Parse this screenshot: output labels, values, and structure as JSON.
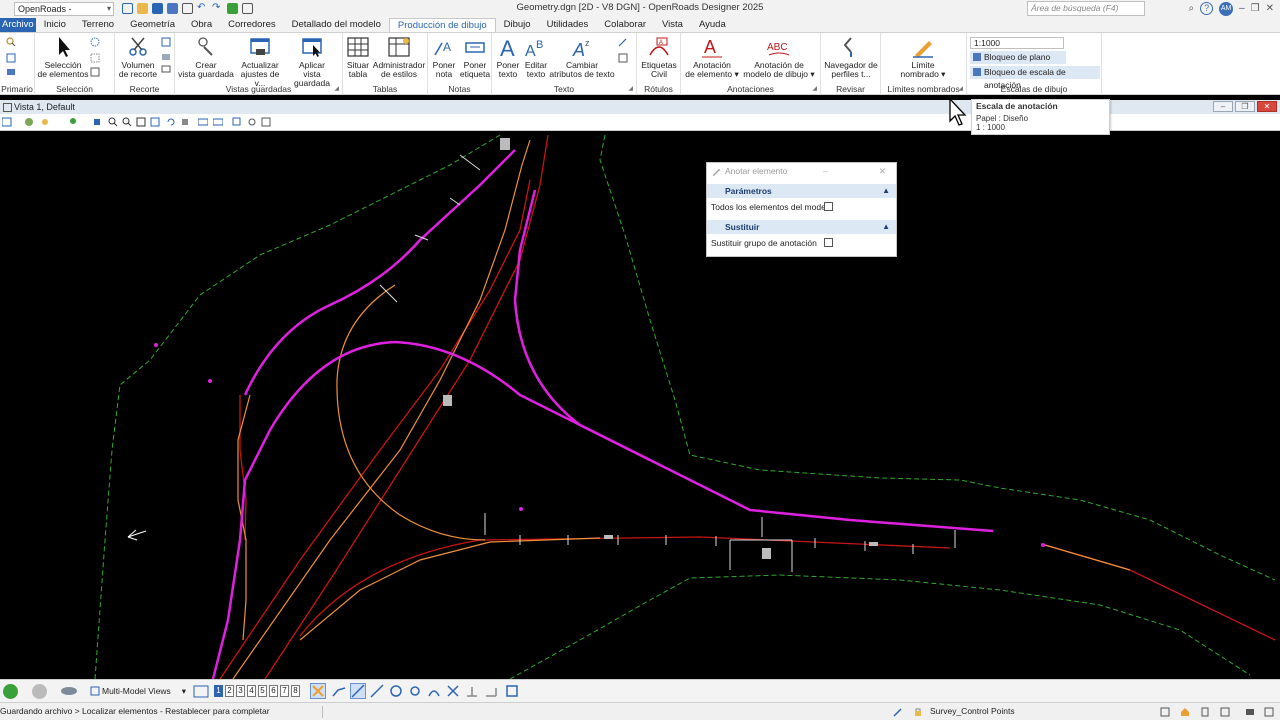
{
  "titlebar": {
    "workspace": "OpenRoads - Modelado",
    "title": "Geometry.dgn [2D - V8 DGN] - OpenRoads Designer 2025",
    "search_placeholder": "Área de búsqueda (F4)",
    "user_initials": "AM",
    "help": "?"
  },
  "tabs": [
    "Archivo",
    "Inicio",
    "Terreno",
    "Geometría",
    "Obra",
    "Corredores",
    "Detallado del modelo",
    "Producción de dibujo",
    "Dibujo",
    "Utilidades",
    "Colaborar",
    "Vista",
    "Ayuda"
  ],
  "active_tab": "Producción de dibujo",
  "ribbon": {
    "groups": {
      "primario": "Primario",
      "seleccion": "Selección",
      "recorte": "Recorte",
      "vistas": "Vistas guardadas",
      "tablas": "Tablas",
      "notas": "Notas",
      "texto": "Texto",
      "rotulos": "Rótulos",
      "anotaciones": "Anotaciones",
      "revisar": "Revisar",
      "limites": "Límites nombrados",
      "escalas": "Escalas de dibujo"
    },
    "buttons": {
      "seleccion1": "Selección",
      "seleccion2": "de elementos",
      "volumen1": "Volumen",
      "volumen2": "de recorte",
      "crear1": "Crear",
      "crear2": "vista guardada",
      "actualizar1": "Actualizar",
      "actualizar2": "ajustes de v...",
      "aplicar1": "Aplicar",
      "aplicar2": "vista guardada",
      "situar1": "Situar",
      "situar2": "tabla",
      "admin1": "Administrador",
      "admin2": "de estilos",
      "poner_nota1": "Poner",
      "poner_nota2": "nota",
      "poner_etiq1": "Poner",
      "poner_etiq2": "etiqueta",
      "poner_texto1": "Poner",
      "poner_texto2": "texto",
      "editar_texto1": "Editar",
      "editar_texto2": "texto",
      "cambiar1": "Cambiar",
      "cambiar2": "atributos de texto",
      "etiquetas1": "Etiquetas",
      "etiquetas2": "Civil",
      "anot_elem1": "Anotación",
      "anot_elem2": "de elemento",
      "anot_modelo1": "Anotación de",
      "anot_modelo2": "modelo de dibujo",
      "navegador1": "Navegador de",
      "navegador2": "perfiles t...",
      "limite1": "Límite",
      "limite2": "nombrado"
    },
    "scale_value": "1:1000",
    "lock_sca": "Bloqueo de plano SCA",
    "lock_annot": "Bloqueo de escala de anotación"
  },
  "tooltip": {
    "title": "Escala de anotación",
    "line1": "Papel : Diseño",
    "line2": "1 : 1000"
  },
  "view": {
    "title": "Vista 1, Default"
  },
  "dialog": {
    "title": "Anotar elemento",
    "section1": "Parámetros",
    "row1": "Todos los elementos del modelo",
    "section2": "Sustituir",
    "row2": "Sustituir grupo de anotación"
  },
  "bottom": {
    "views_select": "Multi-Model Views",
    "view_numbers": [
      "1",
      "2",
      "3",
      "4",
      "5",
      "6",
      "7",
      "8"
    ]
  },
  "status": {
    "message": "Guardando archivo > Localizar elementos - Restablecer para completar",
    "level": "Survey_Control Points"
  },
  "colors": {
    "magenta": "#e020e0",
    "orange": "#f0903a",
    "red": "#d01010",
    "green_dashed": "#2faa2f",
    "accent": "#2a65b3"
  }
}
